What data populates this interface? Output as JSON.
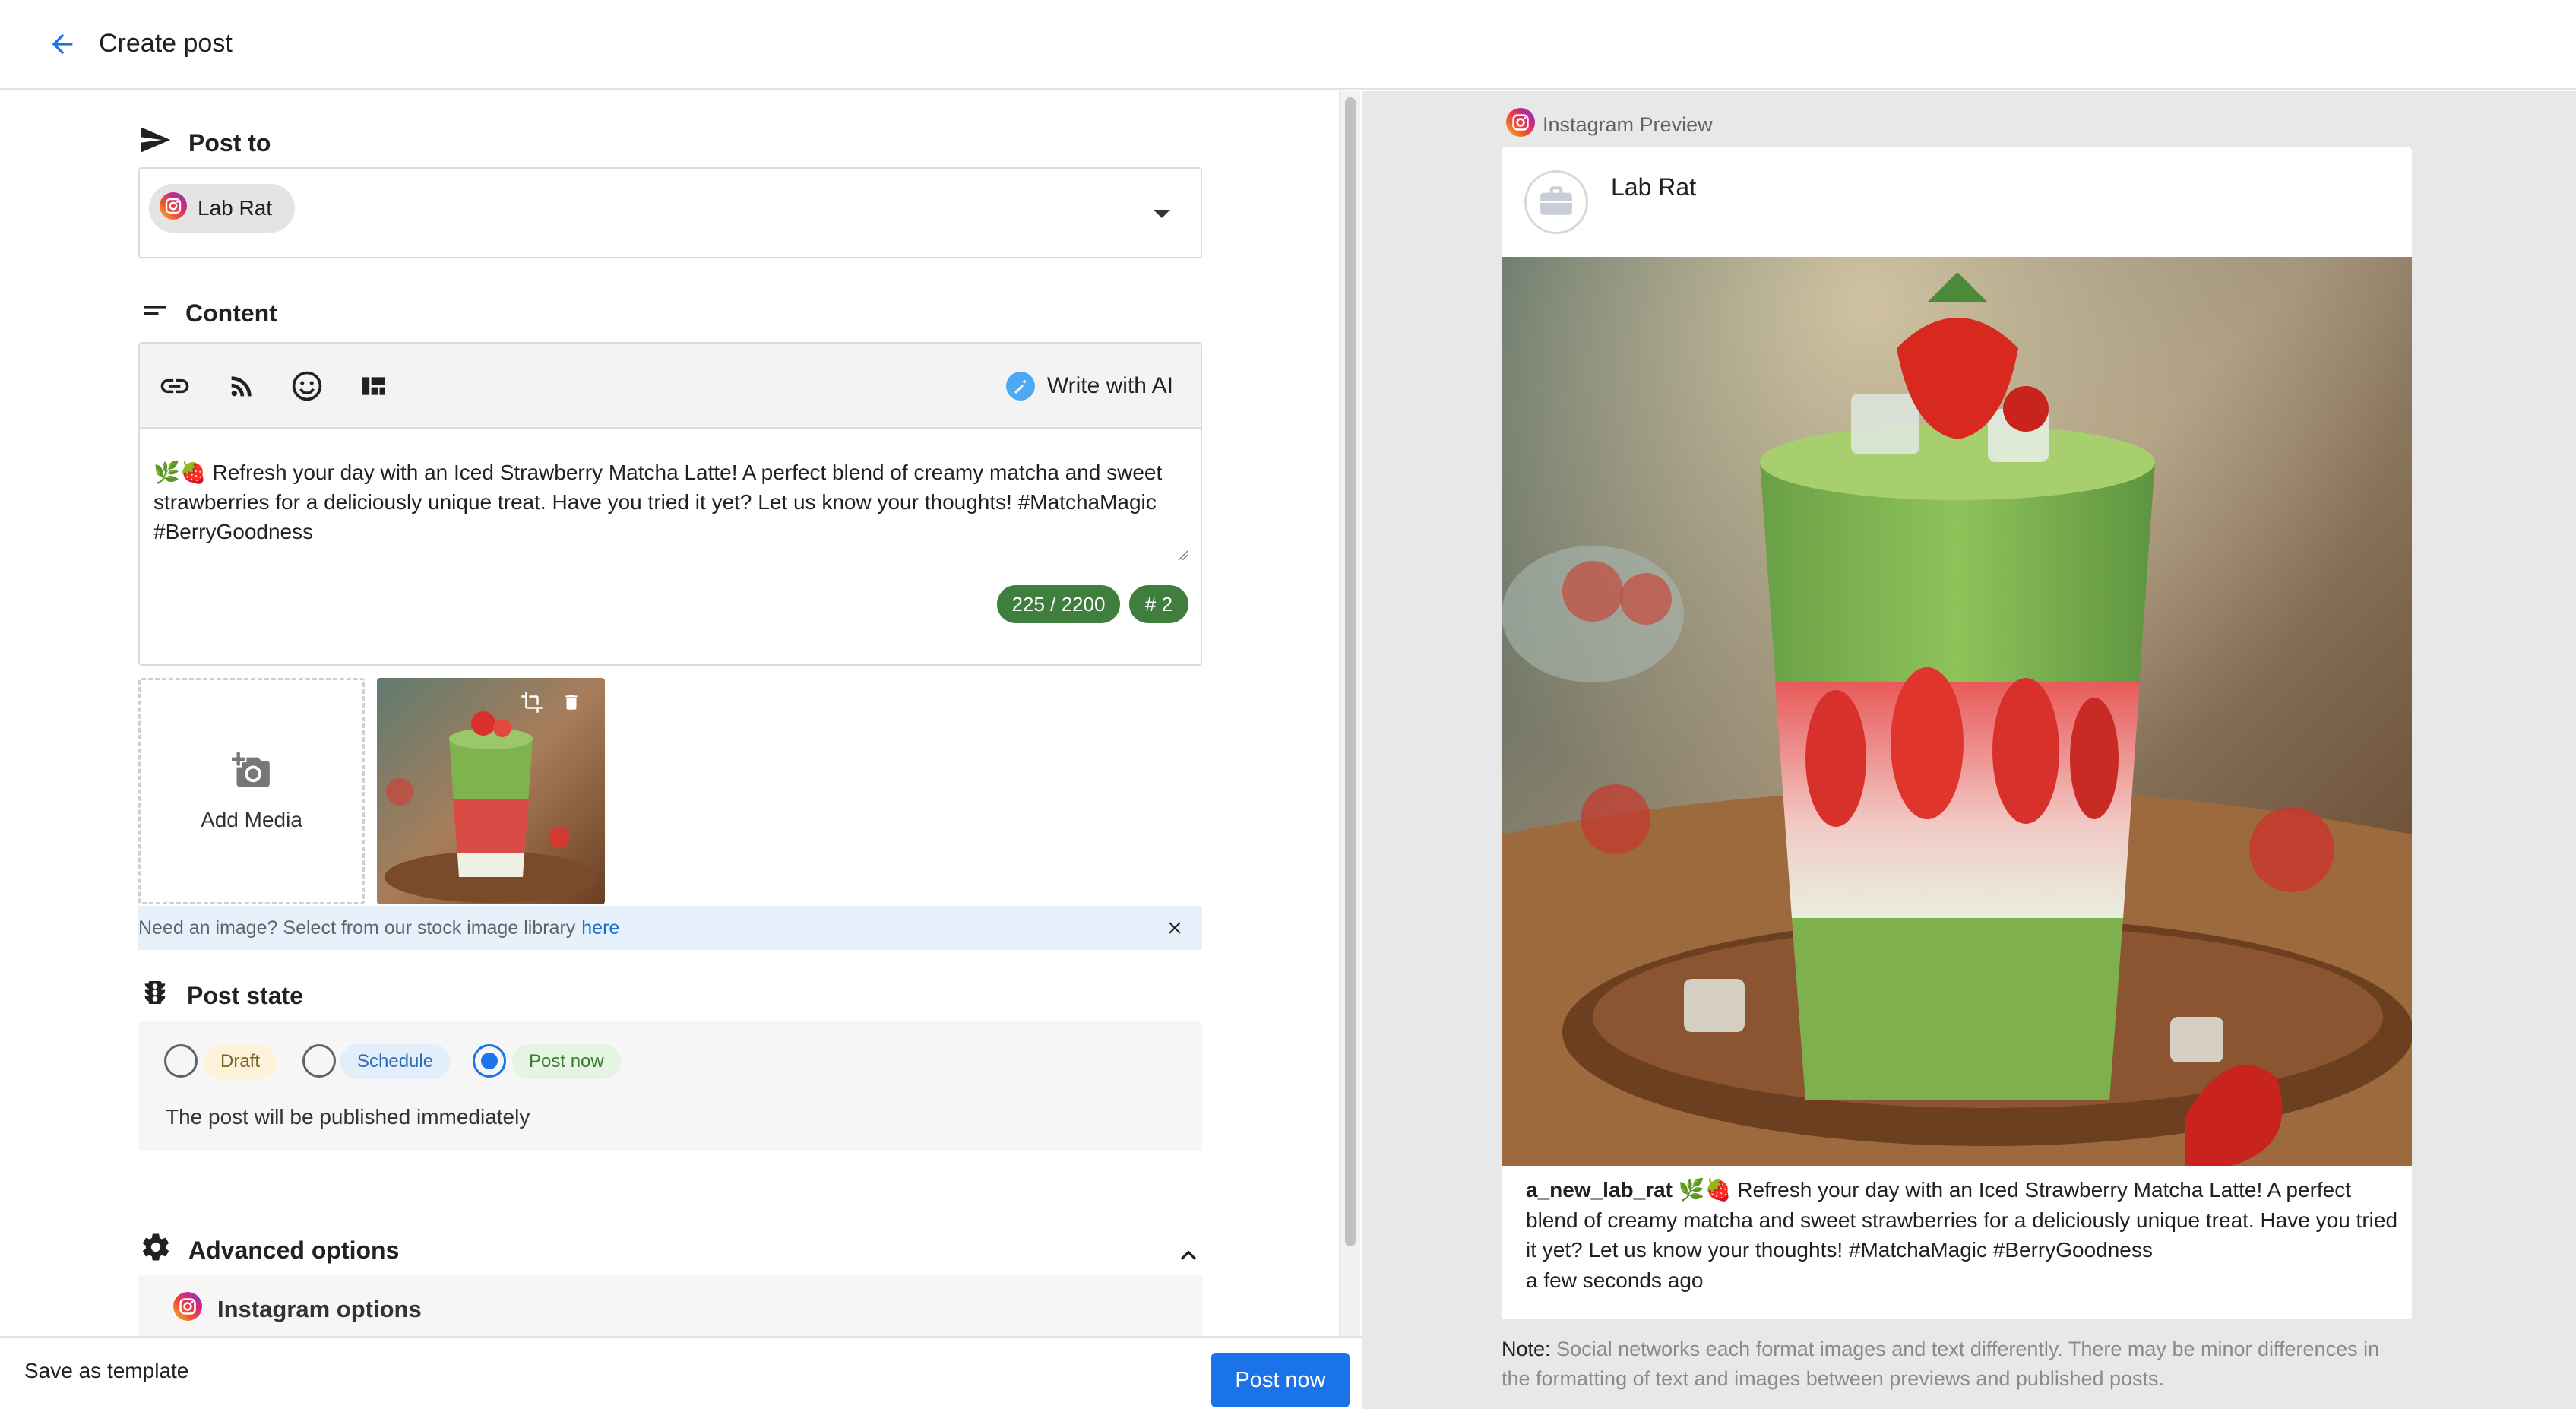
{
  "header": {
    "title": "Create post"
  },
  "post_to": {
    "title": "Post to",
    "account_chip": "Lab Rat"
  },
  "content": {
    "title": "Content",
    "write_with_ai": "Write with AI",
    "text": "🌿🍓 Refresh your day with an Iced Strawberry Matcha Latte! A perfect blend of creamy matcha and sweet strawberries for a deliciously unique treat. Have you tried it yet? Let us know your thoughts! #MatchaMagic #BerryGoodness",
    "char_count": "225 / 2200",
    "hashtag_count": "# 2"
  },
  "media": {
    "add_label": "Add Media",
    "stock_text": "Need an image? Select from our stock image library",
    "stock_link": "here"
  },
  "post_state": {
    "title": "Post state",
    "options": [
      "Draft",
      "Schedule",
      "Post now"
    ],
    "selected": "Post now",
    "description": "The post will be published immediately"
  },
  "advanced": {
    "title": "Advanced options",
    "instagram_options": "Instagram options"
  },
  "footer": {
    "save_template": "Save as template",
    "post_now": "Post now"
  },
  "preview": {
    "label": "Instagram Preview",
    "account_name": "Lab Rat",
    "username": "a_new_lab_rat",
    "caption": "🌿🍓 Refresh your day with an Iced Strawberry Matcha Latte! A perfect blend of creamy matcha and sweet strawberries for a deliciously unique treat. Have you tried it yet? Let us know your thoughts! #MatchaMagic #BerryGoodness",
    "timestamp": "a few seconds ago",
    "note_label": "Note:",
    "note_text": "Social networks each format images and text differently. There may be minor differences in the formatting of text and images between previews and published posts."
  },
  "colors": {
    "accent": "#1a73e8",
    "counter_green": "#3f7e3c",
    "draft_pill": "#fcf3da",
    "schedule_pill": "#e3eefb",
    "postnow_pill": "#e6f4e3"
  },
  "icons": [
    "back-arrow-icon",
    "send-icon",
    "lines-icon",
    "link-icon",
    "rss-icon",
    "emoji-icon",
    "layout-icon",
    "magic-wand-icon",
    "instagram-icon",
    "add-photo-icon",
    "crop-icon",
    "trash-icon",
    "close-icon",
    "traffic-light-icon",
    "gear-icon",
    "chevron-up-icon",
    "briefcase-icon"
  ]
}
